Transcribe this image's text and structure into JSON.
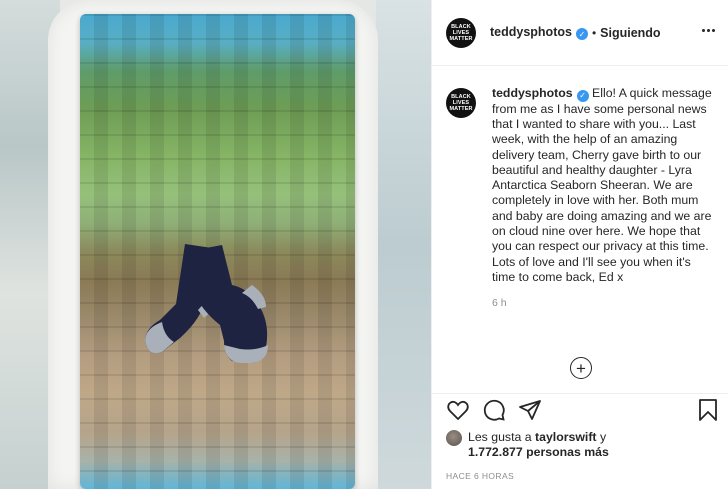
{
  "post": {
    "author": {
      "username": "teddysphotos",
      "avatar_text": "BLACK\nLIVES\nMATTER",
      "verified": true
    },
    "follow_status": "Siguiendo",
    "separator": "•",
    "caption": {
      "username": "teddysphotos",
      "text": "Ello! A quick message from me as I have some personal news that I wanted to share with you... Last week, with the help of an amazing delivery team, Cherry gave birth to our beautiful and healthy daughter - Lyra Antarctica Seaborn Sheeran. We are completely in love with her. Both mum and baby are doing amazing and we are on cloud nine over here. We hope that you can respect our privacy at this time. Lots of love and I'll see you when it's time to come back, Ed x",
      "time": "6 h"
    },
    "likes": {
      "prefix": "Les gusta a",
      "user": "taylorswift",
      "connector": "y",
      "count": "1.772.877 personas más"
    },
    "timestamp": "HACE 6 HORAS",
    "icons": [
      "more-icon",
      "verified-badge-icon",
      "load-more-icon",
      "heart-icon",
      "comment-icon",
      "share-icon",
      "bookmark-icon"
    ],
    "colors": {
      "verified": "#3897f0",
      "text": "#262626",
      "muted": "#8e8e8e",
      "border": "#efefef"
    }
  }
}
